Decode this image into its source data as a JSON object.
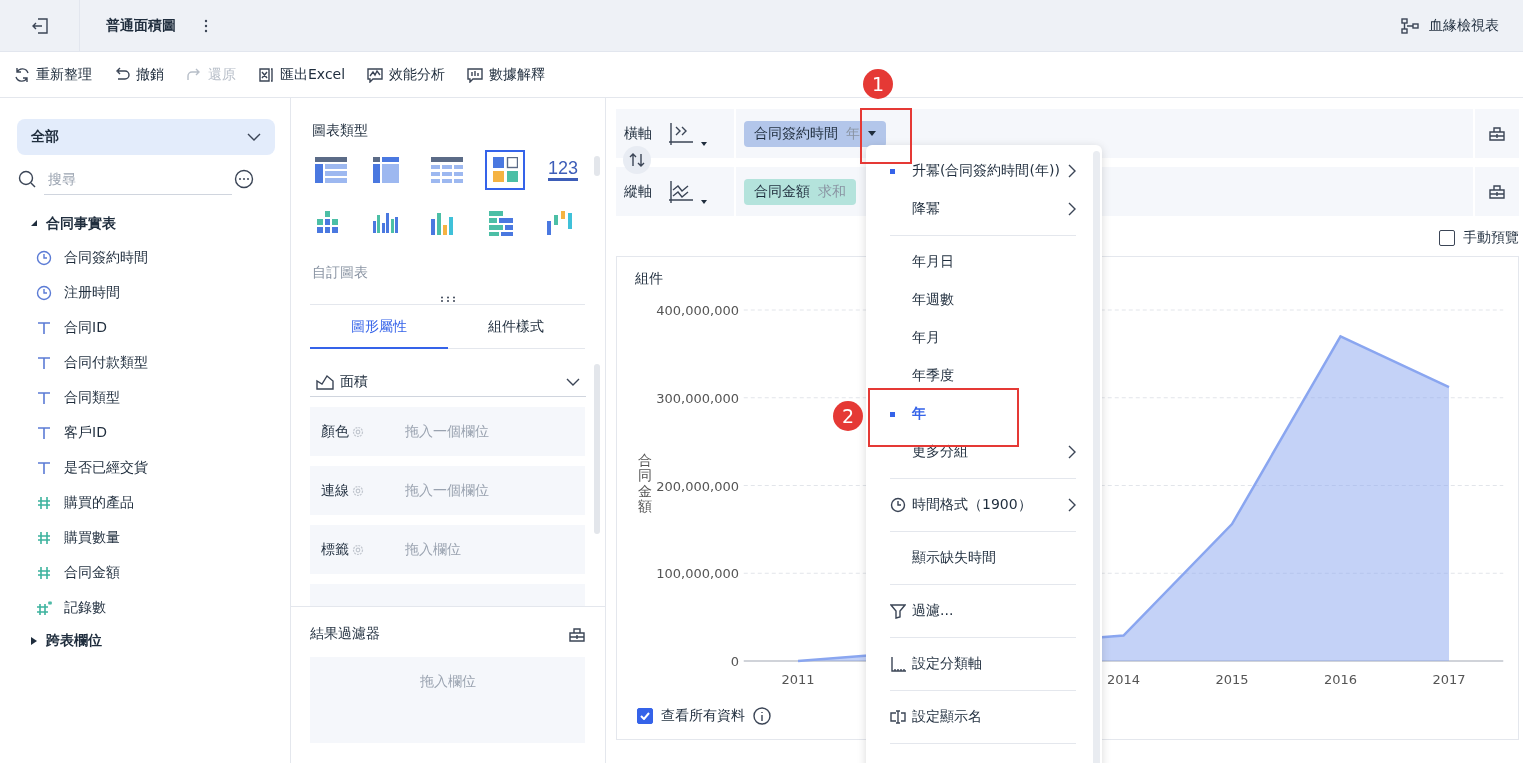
{
  "header": {
    "title": "普通面積圖",
    "lineage_label": "血緣檢視表"
  },
  "toolbar": [
    {
      "label": "重新整理",
      "disabled": false
    },
    {
      "label": "撤銷",
      "disabled": false
    },
    {
      "label": "還原",
      "disabled": true
    },
    {
      "label": "匯出Excel",
      "disabled": false
    },
    {
      "label": "效能分析",
      "disabled": false
    },
    {
      "label": "數據解釋",
      "disabled": false
    }
  ],
  "fields_panel": {
    "scope": "全部",
    "search": {
      "placeholder": "搜尋"
    },
    "tree": [
      {
        "label": "合同事實表",
        "expanded": true,
        "children": [
          {
            "label": "合同簽約時間",
            "kind": "date"
          },
          {
            "label": "注册時間",
            "kind": "date"
          },
          {
            "label": "合同ID",
            "kind": "text"
          },
          {
            "label": "合同付款類型",
            "kind": "text"
          },
          {
            "label": "合同類型",
            "kind": "text"
          },
          {
            "label": "客戶ID",
            "kind": "text"
          },
          {
            "label": "是否已經交貨",
            "kind": "text"
          },
          {
            "label": "購買的產品",
            "kind": "number"
          },
          {
            "label": "購買數量",
            "kind": "number"
          },
          {
            "label": "合同金額",
            "kind": "number"
          },
          {
            "label": "記錄數",
            "kind": "calculated"
          }
        ]
      },
      {
        "label": "跨表欄位",
        "expanded": false
      }
    ]
  },
  "chart_types": {
    "title": "圖表類型",
    "items": [
      {
        "selected": false
      },
      {
        "selected": false
      },
      {
        "selected": false
      },
      {
        "selected": true
      },
      {
        "selected": false,
        "label": "123"
      },
      {
        "selected": false
      },
      {
        "selected": false
      },
      {
        "selected": false
      },
      {
        "selected": false
      },
      {
        "selected": false
      }
    ],
    "custom_label": "自訂圖表"
  },
  "properties": {
    "tabs": [
      {
        "label": "圖形屬性",
        "selected": true
      },
      {
        "label": "組件樣式",
        "selected": false
      }
    ],
    "mark_type": "面積",
    "slots": [
      {
        "label": "顏色",
        "hint": "拖入一個欄位"
      },
      {
        "label": "連線",
        "hint": "拖入一個欄位"
      },
      {
        "label": "標籤",
        "hint": "拖入欄位"
      }
    ]
  },
  "result_filter": {
    "title": "結果過濾器",
    "hint": "拖入欄位"
  },
  "axes": [
    {
      "label": "橫軸",
      "field": "合同簽約時間",
      "modifier": "年",
      "color": "#b3c6ea",
      "expanded": true
    },
    {
      "label": "縱軸",
      "field": "合同金額",
      "modifier": "求和",
      "color": "#b4e3dc",
      "expanded": false
    }
  ],
  "manual_preview": {
    "label": "手動預覽",
    "checked": false
  },
  "chart": {
    "title": "組件",
    "show_all": {
      "label": "查看所有資料",
      "checked": true
    },
    "chart_data": {
      "type": "area",
      "ylabel": "合同金額",
      "x": [
        2011,
        2014,
        2015,
        2016,
        2017
      ],
      "xticks": [
        2011,
        2014,
        2015,
        2016,
        2017
      ],
      "xlim": [
        2010.5,
        2017.5
      ],
      "grid": true,
      "series": [
        {
          "color": "#8aa6f0",
          "values": [
            0,
            29000000,
            156000000,
            370000000,
            312000000
          ]
        }
      ],
      "ylim": [
        0,
        400000000
      ],
      "yticks": [
        {
          "value": 0,
          "label": "0"
        },
        {
          "value": 100000000,
          "label": "100,000,000"
        },
        {
          "value": 200000000,
          "label": "200,000,000"
        },
        {
          "value": 300000000,
          "label": "300,000,000"
        },
        {
          "value": 400000000,
          "label": "400,000,000"
        }
      ]
    }
  },
  "context_menu": {
    "groups": [
      {
        "kind": "sort",
        "items": [
          {
            "label": "升冪(合同簽約時間(年))",
            "selected": true,
            "submenu": true
          },
          {
            "label": "降冪",
            "selected": false,
            "submenu": true
          }
        ]
      },
      {
        "kind": "grouping",
        "items": [
          {
            "label": "年月日",
            "selected": false,
            "submenu": false
          },
          {
            "label": "年週數",
            "selected": false,
            "submenu": false
          },
          {
            "label": "年月",
            "selected": false,
            "submenu": false
          },
          {
            "label": "年季度",
            "selected": false,
            "submenu": false
          },
          {
            "label": "年",
            "selected": true,
            "submenu": false
          },
          {
            "label": "更多分組",
            "selected": false,
            "submenu": true
          }
        ]
      },
      {
        "kind": "time-format",
        "items": [
          {
            "label": "時間格式（1900）",
            "selected": false,
            "submenu": true
          }
        ]
      },
      {
        "kind": "plain",
        "items": [
          {
            "label": "顯示缺失時間",
            "selected": false,
            "submenu": false
          }
        ]
      },
      {
        "kind": "filter",
        "items": [
          {
            "label": "過濾...",
            "selected": false,
            "submenu": false
          }
        ]
      },
      {
        "kind": "axis",
        "items": [
          {
            "label": "設定分類軸",
            "selected": false,
            "submenu": false
          }
        ]
      },
      {
        "kind": "rename",
        "items": [
          {
            "label": "設定顯示名",
            "selected": false,
            "submenu": false
          }
        ]
      }
    ]
  },
  "annotations": [
    {
      "label": "1"
    },
    {
      "label": "2"
    }
  ]
}
